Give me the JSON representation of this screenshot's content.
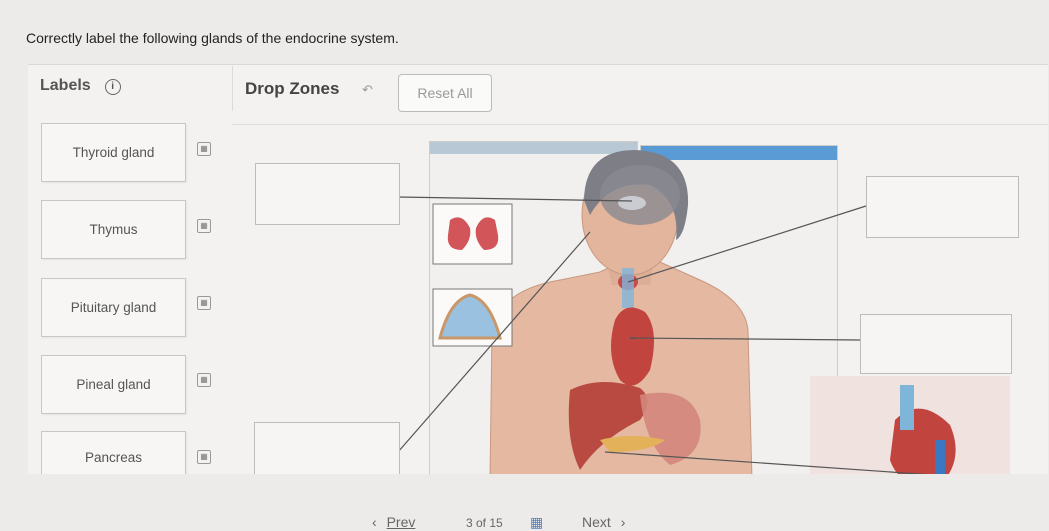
{
  "question": "Correctly label the following glands of the endocrine system.",
  "labels_panel": {
    "title": "Labels",
    "info_glyph": "i"
  },
  "drop_panel": {
    "title": "Drop Zones",
    "reset_label": "Reset All"
  },
  "labels": [
    "Thyroid gland",
    "Thymus",
    "Pituitary gland",
    "Pineal gland",
    "Pancreas"
  ],
  "pager": {
    "prev": "Prev",
    "position": "3 of 15",
    "next": "Next"
  },
  "icons": [
    "info-icon",
    "undo-icon",
    "drag-handle-icon",
    "grid-icon",
    "chevron-left-icon",
    "chevron-right-icon"
  ],
  "colors": {
    "background": "#ecebea",
    "panel_header_blue": "#5b9bd5",
    "skin": "#e4b8a1",
    "organ_red": "#c2443f"
  }
}
